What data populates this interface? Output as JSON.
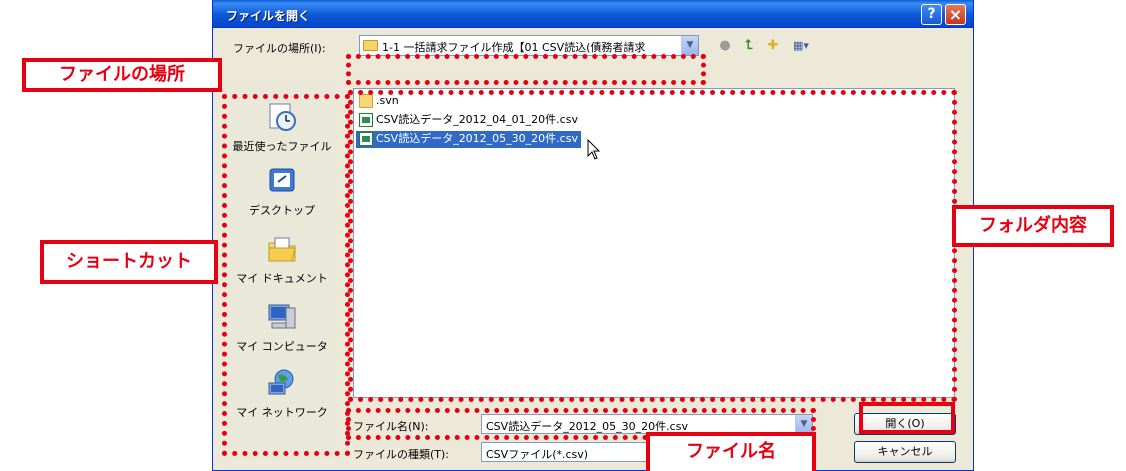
{
  "dialog": {
    "title": "ファイルを開く",
    "help_button": "?",
    "close_button": "×"
  },
  "look_in": {
    "label": "ファイルの場所(I):",
    "value": "1-1 一括請求ファイル作成【01 CSV読込(債務者請求"
  },
  "places": [
    {
      "label": "最近使ったファイル",
      "icon": "recent-files-icon"
    },
    {
      "label": "デスクトップ",
      "icon": "desktop-icon"
    },
    {
      "label": "マイ ドキュメント",
      "icon": "my-documents-icon"
    },
    {
      "label": "マイ コンピュータ",
      "icon": "my-computer-icon"
    },
    {
      "label": "マイ ネットワーク",
      "icon": "my-network-icon"
    }
  ],
  "files": [
    {
      "name": ".svn",
      "type": "folder"
    },
    {
      "name": "CSV読込データ_2012_04_01_20件.csv",
      "type": "csv"
    },
    {
      "name": "CSV読込データ_2012_05_30_20件.csv",
      "type": "csv",
      "selected": true
    }
  ],
  "file_name": {
    "label": "ファイル名(N):",
    "value": "CSV読込データ_2012_05_30_20件.csv"
  },
  "file_type": {
    "label": "ファイルの種類(T):",
    "value": "CSVファイル(*.csv)"
  },
  "buttons": {
    "open": "開く(O)",
    "cancel": "キャンセル"
  },
  "annotations": {
    "location": "ファイルの場所",
    "shortcut": "ショートカット",
    "folder_content": "フォルダ内容",
    "file_name": "ファイル名"
  },
  "colors": {
    "annotation": "#e60012",
    "selection": "#316ac5",
    "titlebar": "#0b58d6"
  }
}
